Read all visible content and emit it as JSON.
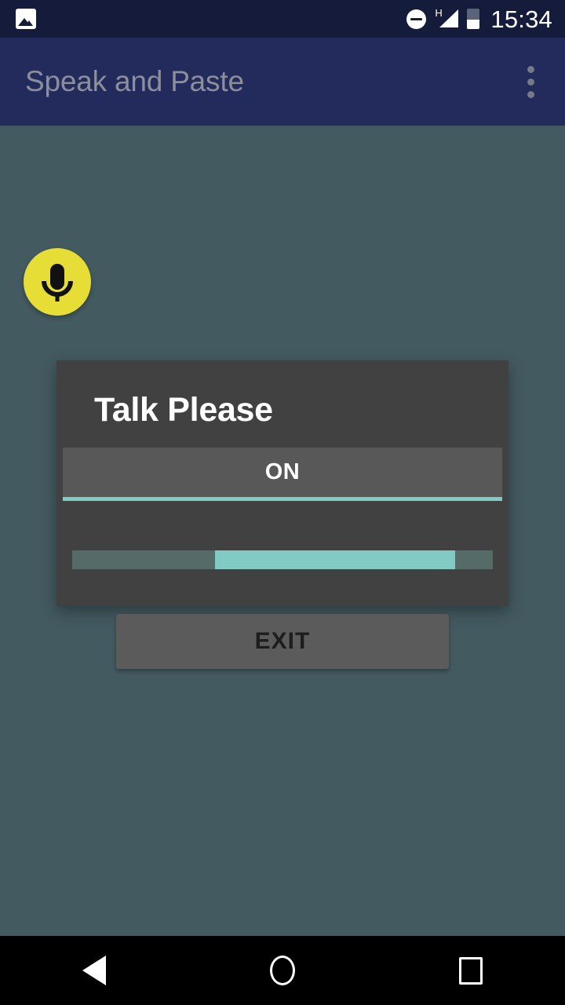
{
  "status_bar": {
    "left_icons": [
      {
        "name": "photo-icon",
        "label": "screenshot-notification"
      }
    ],
    "right_icons": [
      {
        "name": "do-not-disturb-icon",
        "label": "do-not-disturb"
      },
      {
        "name": "signal-icon",
        "label": "H",
        "network_type": "H"
      },
      {
        "name": "battery-icon",
        "label": "battery",
        "fill_percent": 46
      }
    ],
    "clock": "15:34",
    "background_color": "#151b3b",
    "foreground_color": "#ffffff"
  },
  "app_bar": {
    "title": "Speak and Paste",
    "title_color": "#8b8f9c",
    "background_color": "#232a5c",
    "overflow_menu_label": "More options"
  },
  "content": {
    "background_color": "#435a60",
    "fab": {
      "name": "microphone-fab",
      "label": "Speak",
      "color": "#e6dd37",
      "icon_color": "#111111"
    }
  },
  "dialog": {
    "title": "Talk Please",
    "background_color": "#414141",
    "title_color": "#ffffff",
    "status_field": {
      "value": "ON",
      "accent_color": "#82cbc4",
      "field_background": "#585858"
    },
    "progress": {
      "label": "listening-progress",
      "indeterminate": true,
      "track_color": "#546b67",
      "indicator_color": "#82cbc4",
      "indicator_start_percent": 34,
      "indicator_width_percent": 57
    }
  },
  "exit_button": {
    "label": "EXIT",
    "background_color": "#5b5b5b",
    "text_color": "#1d1d1d"
  },
  "nav_bar": {
    "background_color": "#000000",
    "buttons": [
      {
        "name": "nav-back-button",
        "label": "Back"
      },
      {
        "name": "nav-home-button",
        "label": "Home"
      },
      {
        "name": "nav-recents-button",
        "label": "Recents"
      }
    ]
  }
}
